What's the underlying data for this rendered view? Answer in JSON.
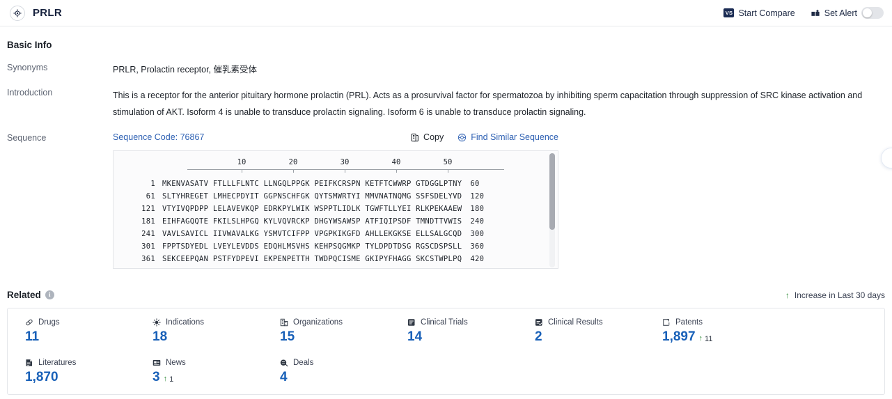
{
  "header": {
    "title": "PRLR",
    "logo_icon": "target-icon",
    "compare_label": "Start Compare",
    "compare_badge": "VS",
    "alert_label": "Set Alert",
    "alert_toggle_on": false
  },
  "basic_info": {
    "section_title": "Basic Info",
    "rows": [
      {
        "label": "Synonyms",
        "value": "PRLR, Prolactin receptor, 催乳素受体"
      },
      {
        "label": "Introduction",
        "value": "This is a receptor for the anterior pituitary hormone prolactin (PRL). Acts as a prosurvival factor for spermatozoa by inhibiting sperm capacitation through suppression of SRC kinase activation and stimulation of AKT. Isoform 4 is unable to transduce prolactin signaling. Isoform 6 is unable to transduce prolactin signaling."
      },
      {
        "label": "Sequence",
        "value": ""
      }
    ]
  },
  "sequence": {
    "code_label": "Sequence Code: 76867",
    "copy_label": "Copy",
    "copy_icon": "copy-icon",
    "similar_label": "Find Similar Sequence",
    "similar_icon": "find-similar-icon",
    "ruler_ticks": [
      10,
      20,
      30,
      40,
      50
    ],
    "lines": [
      {
        "start": "1",
        "blocks": "MKENVASATV FTLLLFLNTC LLNGQLPPGK PEIFKCRSPN KETFTCWWRP GTDGGLPTNY",
        "end": "60"
      },
      {
        "start": "61",
        "blocks": "SLTYHREGET LMHECPDYIT GGPNSCHFGK QYTSMWRTYI MMVNATNQMG SSFSDELYVD",
        "end": "120"
      },
      {
        "start": "121",
        "blocks": "VTYIVQPDPP LELAVEVKQP EDRKPYLWIK WSPPTLIDLK TGWFTLLYEI RLKPEKAAEW",
        "end": "180"
      },
      {
        "start": "181",
        "blocks": "EIHFAGQQTE FKILSLHPGQ KYLVQVRCKP DHGYWSAWSP ATFIQIPSDF TMNDTTVWIS",
        "end": "240"
      },
      {
        "start": "241",
        "blocks": "VAVLSAVICL IIVWAVALKG YSMVTCIFPP VPGPKIKGFD AHLLEKGKSE ELLSALGCQD",
        "end": "300"
      },
      {
        "start": "301",
        "blocks": "FPPTSDYEDL LVEYLEVDDS EDQHLMSVHS KEHPSQGMKP TYLDPDTDSG RGSCDSPSLL",
        "end": "360"
      },
      {
        "start": "361",
        "blocks": "SEKCEEPQAN PSTFYDPEVI EKPENPETTH TWDPQCISME GKIPYFHAGG SKCSTWPLPQ",
        "end": "420"
      }
    ]
  },
  "related": {
    "title": "Related",
    "info_icon": "info-icon",
    "increase_note": "Increase in Last 30 days",
    "increase_arrow": "arrow-up-icon",
    "cards": [
      {
        "label": "Drugs",
        "icon": "pill-icon",
        "value": "11",
        "delta": ""
      },
      {
        "label": "Indications",
        "icon": "virus-icon",
        "value": "18",
        "delta": ""
      },
      {
        "label": "Organizations",
        "icon": "building-icon",
        "value": "15",
        "delta": ""
      },
      {
        "label": "Clinical Trials",
        "icon": "clinical-trial-icon",
        "value": "14",
        "delta": ""
      },
      {
        "label": "Clinical Results",
        "icon": "clinical-result-icon",
        "value": "2",
        "delta": ""
      },
      {
        "label": "Patents",
        "icon": "patent-icon",
        "value": "1,897",
        "delta": "11"
      },
      {
        "label": "Literatures",
        "icon": "literature-icon",
        "value": "1,870",
        "delta": ""
      },
      {
        "label": "News",
        "icon": "news-icon",
        "value": "3",
        "delta": "1"
      },
      {
        "label": "Deals",
        "icon": "deal-icon",
        "value": "4",
        "delta": ""
      }
    ]
  },
  "colors": {
    "accent_blue": "#1860b8",
    "link_blue": "#2c5fb2",
    "increase_green": "#2e8b35",
    "brand_dark": "#16213d"
  }
}
